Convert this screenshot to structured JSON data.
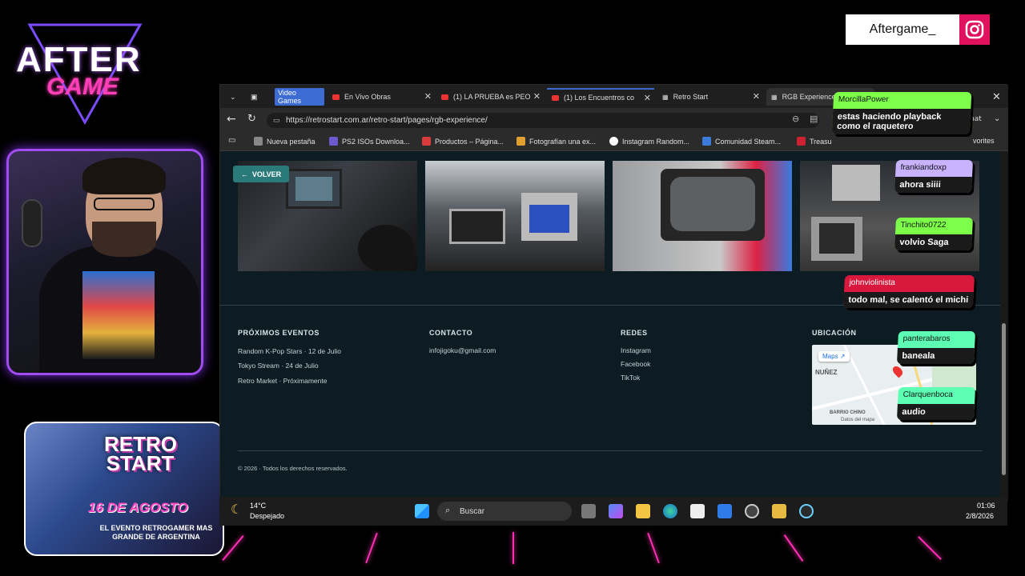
{
  "overlay": {
    "logo_top": "AFTER",
    "logo_bottom": "GAME",
    "instagram_handle": "Aftergame_",
    "promo": {
      "title": "RETRO START",
      "date": "16 DE AGOSTO",
      "subtitle": "EL EVENTO RETROGAMER MAS GRANDE DE ARGENTINA"
    }
  },
  "browser": {
    "tabs": [
      {
        "label": "Video Games",
        "type": "group"
      },
      {
        "label": "En Vivo Obras",
        "icon": "youtube-icon"
      },
      {
        "label": "(1) LA PRUEBA es PEO",
        "icon": "youtube-icon"
      },
      {
        "label": "(1) Los Encuentros co",
        "icon": "youtube-icon"
      },
      {
        "label": "Retro Start",
        "icon": "site-icon"
      },
      {
        "label": "RGB Experience - Retr",
        "icon": "site-icon",
        "active": true
      }
    ],
    "url": "https://retrostart.com.ar/retro-start/pages/rgb-experience/",
    "right_label": "hat",
    "bookmarks": [
      {
        "label": "Nueva pestaña",
        "color": "#888888"
      },
      {
        "label": "PS2 ISOs Downloa...",
        "color": "#6a5acd"
      },
      {
        "label": "Productos – Página...",
        "color": "#d93b3b"
      },
      {
        "label": "Fotografían una ex...",
        "color": "#e0a030"
      },
      {
        "label": "Instagram Random...",
        "color": "#ffffff"
      },
      {
        "label": "Comunidad Steam...",
        "color": "#3b7bd9"
      },
      {
        "label": "Treasu",
        "color": "#c23"
      }
    ],
    "bookmarks_end": "vorites"
  },
  "page": {
    "back_button": "VOLVER",
    "footer": {
      "events_title": "PRÓXIMOS EVENTOS",
      "events": [
        "Random K-Pop Stars · 12 de Julio",
        "Tokyo Stream · 24 de Julio",
        "Retro Market · Próximamente"
      ],
      "contact_title": "CONTACTO",
      "contact_email": "infojigoku@gmail.com",
      "social_title": "REDES",
      "social": [
        "Instagram",
        "Facebook",
        "TikTok"
      ],
      "location_title": "UBICACIÓN",
      "map_button": "Maps",
      "map_labels": {
        "area": "NUÑEZ",
        "district": "BARRIO CHINO",
        "data": "Datos del mapa"
      },
      "copyright": "© 2026 · Todos los derechos reservados."
    }
  },
  "taskbar": {
    "temp": "14°C",
    "weather": "Despejado",
    "search_placeholder": "Buscar",
    "time": "01:06",
    "date": "2/8/2026"
  },
  "chat": [
    {
      "user": "MorcillaPower",
      "message": "estas haciendo playback como el raquetero",
      "color": "#7dff4a"
    },
    {
      "user": "frankiandoxp",
      "message": "ahora siiii",
      "color": "#c9b3ff"
    },
    {
      "user": "Tinchito0722",
      "message": "volvio Saga",
      "color": "#7dff4a"
    },
    {
      "user": "johnviolinista",
      "message": "todo mal, se calentó el michi",
      "color": "#d8193d"
    },
    {
      "user": "panterabaros",
      "message": "baneala",
      "color": "#5dffb4"
    },
    {
      "user": "Clarquenboca",
      "message": "audio",
      "color": "#5dffb4"
    }
  ]
}
